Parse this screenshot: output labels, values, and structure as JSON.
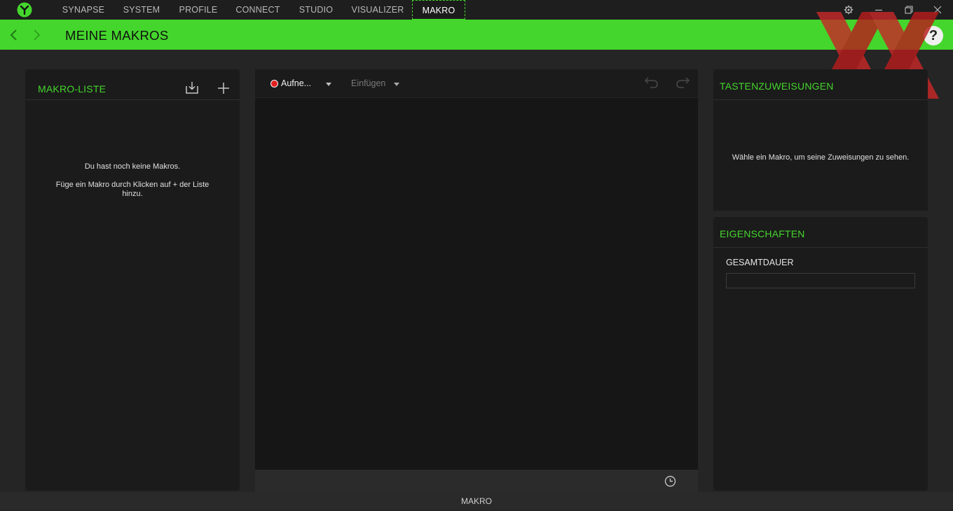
{
  "nav": {
    "tabs": [
      "SYNAPSE",
      "SYSTEM",
      "PROFILE",
      "CONNECT",
      "STUDIO",
      "VISUALIZER",
      "MAKRO"
    ],
    "active_tab": "MAKRO"
  },
  "header": {
    "title": "MEINE MAKROS",
    "help_label": "?"
  },
  "macro_list": {
    "title": "MAKRO-LISTE",
    "empty_line1": "Du hast noch keine Makros.",
    "empty_line2": "Füge ein Makro durch Klicken auf + der Liste",
    "empty_line3": "hinzu."
  },
  "editor": {
    "record_label": "Aufne...",
    "insert_label": "Einfügen"
  },
  "assignments": {
    "title": "TASTENZUWEISUNGEN",
    "empty_text": "Wähle ein Makro, um seine Zuweisungen zu sehen."
  },
  "properties": {
    "title": "EIGENSCHAFTEN",
    "duration_label": "GESAMTDAUER",
    "duration_value": ""
  },
  "status_bar": {
    "label": "MAKRO"
  },
  "colors": {
    "accent": "#44d62c",
    "record": "#e02020",
    "background": "#252525",
    "panel": "#1b1b1b"
  },
  "icons": [
    "razer-logo-icon",
    "gear-icon",
    "minimize-icon",
    "restore-icon",
    "close-icon",
    "back-arrow-icon",
    "forward-arrow-icon",
    "help-icon",
    "import-icon",
    "add-icon",
    "record-dot-icon",
    "undo-icon",
    "redo-icon",
    "clock-icon"
  ]
}
